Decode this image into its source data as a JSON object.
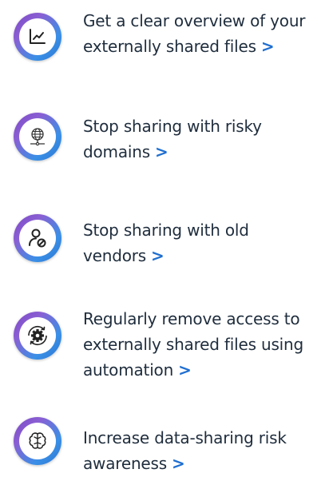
{
  "items": [
    {
      "icon": "chart-icon",
      "lines": [
        "Get a clear overview of your",
        "externally shared files"
      ],
      "link": ">"
    },
    {
      "icon": "globe-network-icon",
      "lines": [
        "Stop sharing with risky",
        "domains"
      ],
      "link": ">"
    },
    {
      "icon": "user-block-icon",
      "lines": [
        "Stop sharing with old",
        "vendors"
      ],
      "link": ">"
    },
    {
      "icon": "gear-automation-icon",
      "lines": [
        "Regularly remove access to",
        "externally shared files using",
        "automation"
      ],
      "link": ">"
    },
    {
      "icon": "brain-icon",
      "lines": [
        "Increase data-sharing risk",
        "awareness"
      ],
      "link": ">"
    }
  ],
  "colors": {
    "text": "#1f2d3d",
    "link": "#1f6fd1",
    "gradient_start": "#7b47c6",
    "gradient_end": "#2b76d3"
  }
}
